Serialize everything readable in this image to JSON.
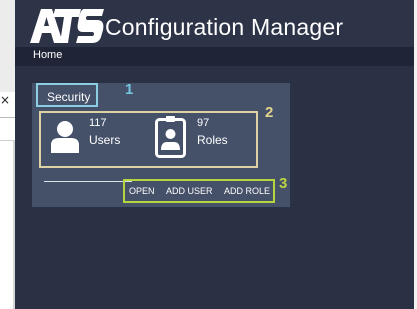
{
  "background_window": {
    "close_glyph": "×"
  },
  "app": {
    "logo_text": "ATS",
    "title": "Configuration Manager",
    "breadcrumb": {
      "home": "Home"
    }
  },
  "security_card": {
    "title": "Security",
    "users": {
      "count": "117",
      "label": "Users",
      "icon": "user-icon"
    },
    "roles": {
      "count": "97",
      "label": "Roles",
      "icon": "id-badge-icon"
    },
    "actions": {
      "open": "OPEN",
      "add_user": "ADD USER",
      "add_role": "ADD ROLE"
    }
  },
  "annotations": {
    "one": "1",
    "two": "2",
    "three": "3"
  },
  "colors": {
    "app_background": "#2a3144",
    "card_background": "#455069",
    "highlight_1": "#8ccfe3",
    "highlight_2": "#ddd2a4",
    "highlight_3": "#b6d43e"
  }
}
